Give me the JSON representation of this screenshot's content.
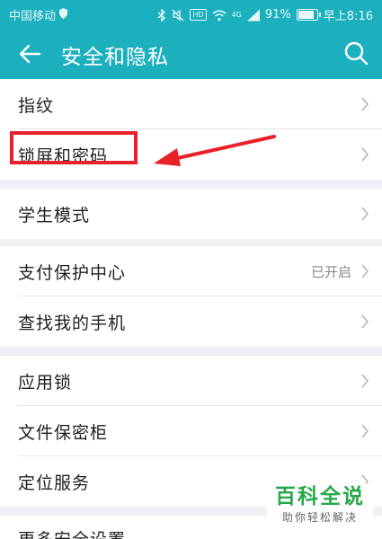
{
  "status_bar": {
    "carrier": "中国移动",
    "network": "4G",
    "battery_percent": "91%",
    "time": "早上8:16"
  },
  "header": {
    "title": "安全和隐私",
    "back_icon": "arrow-left-icon",
    "search_icon": "search-icon"
  },
  "sections": [
    [
      {
        "label": "指纹"
      },
      {
        "label": "锁屏和密码"
      }
    ],
    [
      {
        "label": "学生模式"
      }
    ],
    [
      {
        "label": "支付保护中心",
        "value": "已开启"
      },
      {
        "label": "查找我的手机"
      }
    ],
    [
      {
        "label": "应用锁"
      },
      {
        "label": "文件保密柜"
      },
      {
        "label": "定位服务"
      }
    ],
    [
      {
        "label": "更多安全设置"
      }
    ]
  ],
  "watermark": {
    "title": "百科全说",
    "subtitle": "助你轻松解决"
  },
  "colors": {
    "header": "#1cb0bf",
    "highlight": "#e8212b",
    "watermark": "#27a84a"
  }
}
